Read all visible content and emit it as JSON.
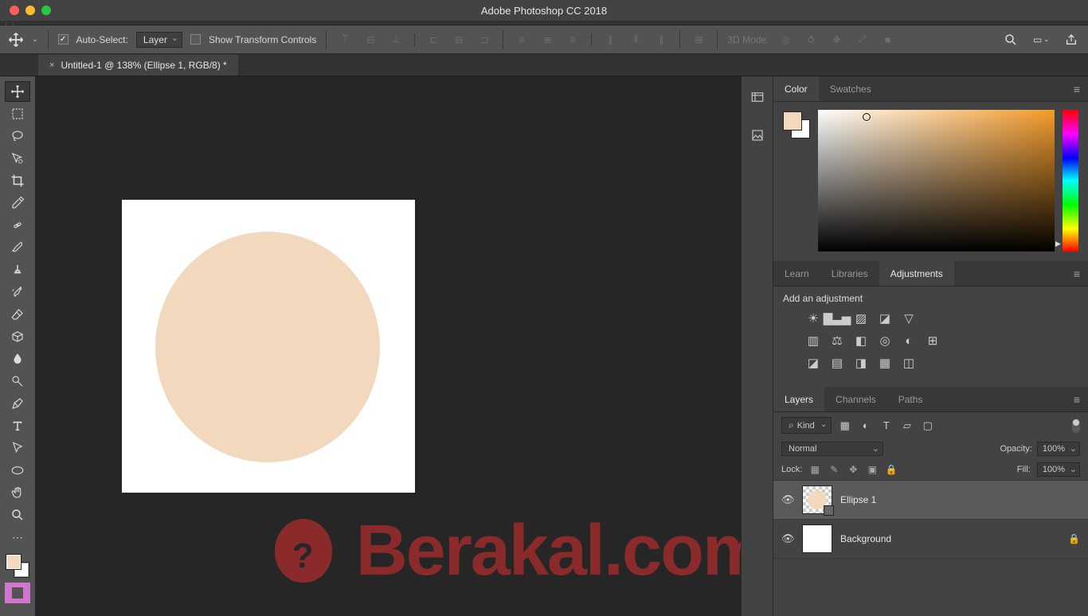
{
  "app_title": "Adobe Photoshop CC 2018",
  "options": {
    "auto_select_label": "Auto-Select:",
    "auto_select_value": "Layer",
    "show_transform_label": "Show Transform Controls",
    "mode_3d_label": "3D Mode:"
  },
  "document": {
    "tab_title": "Untitled-1 @ 138% (Ellipse 1, RGB/8) *"
  },
  "panels": {
    "color_tab": "Color",
    "swatches_tab": "Swatches",
    "learn_tab": "Learn",
    "libraries_tab": "Libraries",
    "adjustments_tab": "Adjustments",
    "adj_add_label": "Add an adjustment",
    "layers_tab": "Layers",
    "channels_tab": "Channels",
    "paths_tab": "Paths"
  },
  "layers": {
    "kind_label": "Kind",
    "blend_mode": "Normal",
    "opacity_label": "Opacity:",
    "opacity_value": "100%",
    "lock_label": "Lock:",
    "fill_label": "Fill:",
    "fill_value": "100%",
    "items": [
      {
        "name": "Ellipse 1"
      },
      {
        "name": "Background"
      }
    ]
  },
  "watermark": "Berakal.com",
  "colors": {
    "ellipse": "#f2d9be"
  }
}
